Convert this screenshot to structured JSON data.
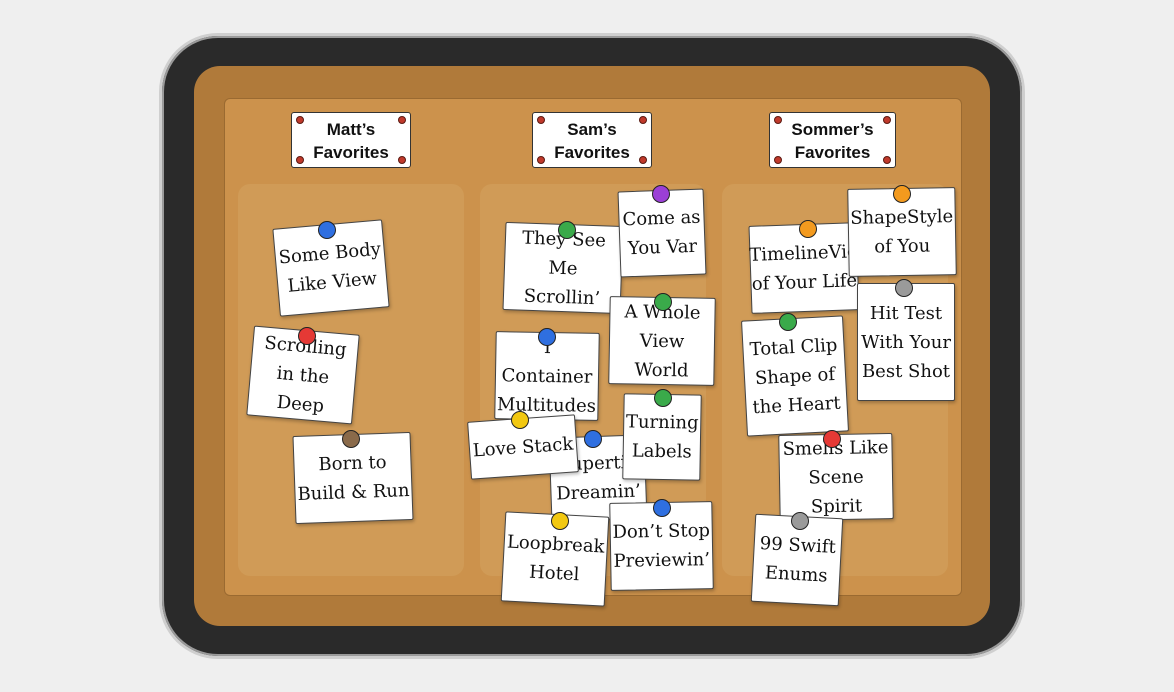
{
  "columns": [
    {
      "title_line1": "Matt’s",
      "title_line2": "Favorites"
    },
    {
      "title_line1": "Sam’s",
      "title_line2": "Favorites"
    },
    {
      "title_line1": "Sommer’s",
      "title_line2": "Favorites"
    }
  ],
  "notes": {
    "some_body": "Some Body\nLike View",
    "scrolling": "Scrolling\nin the Deep",
    "born": "Born to\nBuild & Run",
    "they_see": "They See Me\nScrollin’",
    "come_as": "Come as\nYou Var",
    "whole_view": "A Whole\nView World",
    "container": "I Container\nMultitudes",
    "love_stack": "Love Stack",
    "cupertino": "Cupertin\nDreamin’",
    "turning": "Turning\nLabels",
    "loopbreak": "Loopbreak\nHotel",
    "dont_stop": "Don’t Stop\nPreviewin’",
    "timeline": "TimelineVie\nof Your Life",
    "shapestyle": "ShapeStyle\nof You",
    "hit_test": "Hit Test\nWith Your\nBest Shot",
    "total_clip": "Total Clip\nShape of\nthe Heart",
    "smells": "Smells Like\nScene Spirit",
    "enums": "99 Swift\nEnums"
  },
  "pin_colors": {
    "blue": "#2f6fe0",
    "red": "#e53935",
    "brown": "#8a6a4a",
    "green": "#3aaa4a",
    "purple": "#9b3fd6",
    "yellow": "#f2c811",
    "orange": "#f39a1e",
    "gray": "#9a9a9a"
  }
}
